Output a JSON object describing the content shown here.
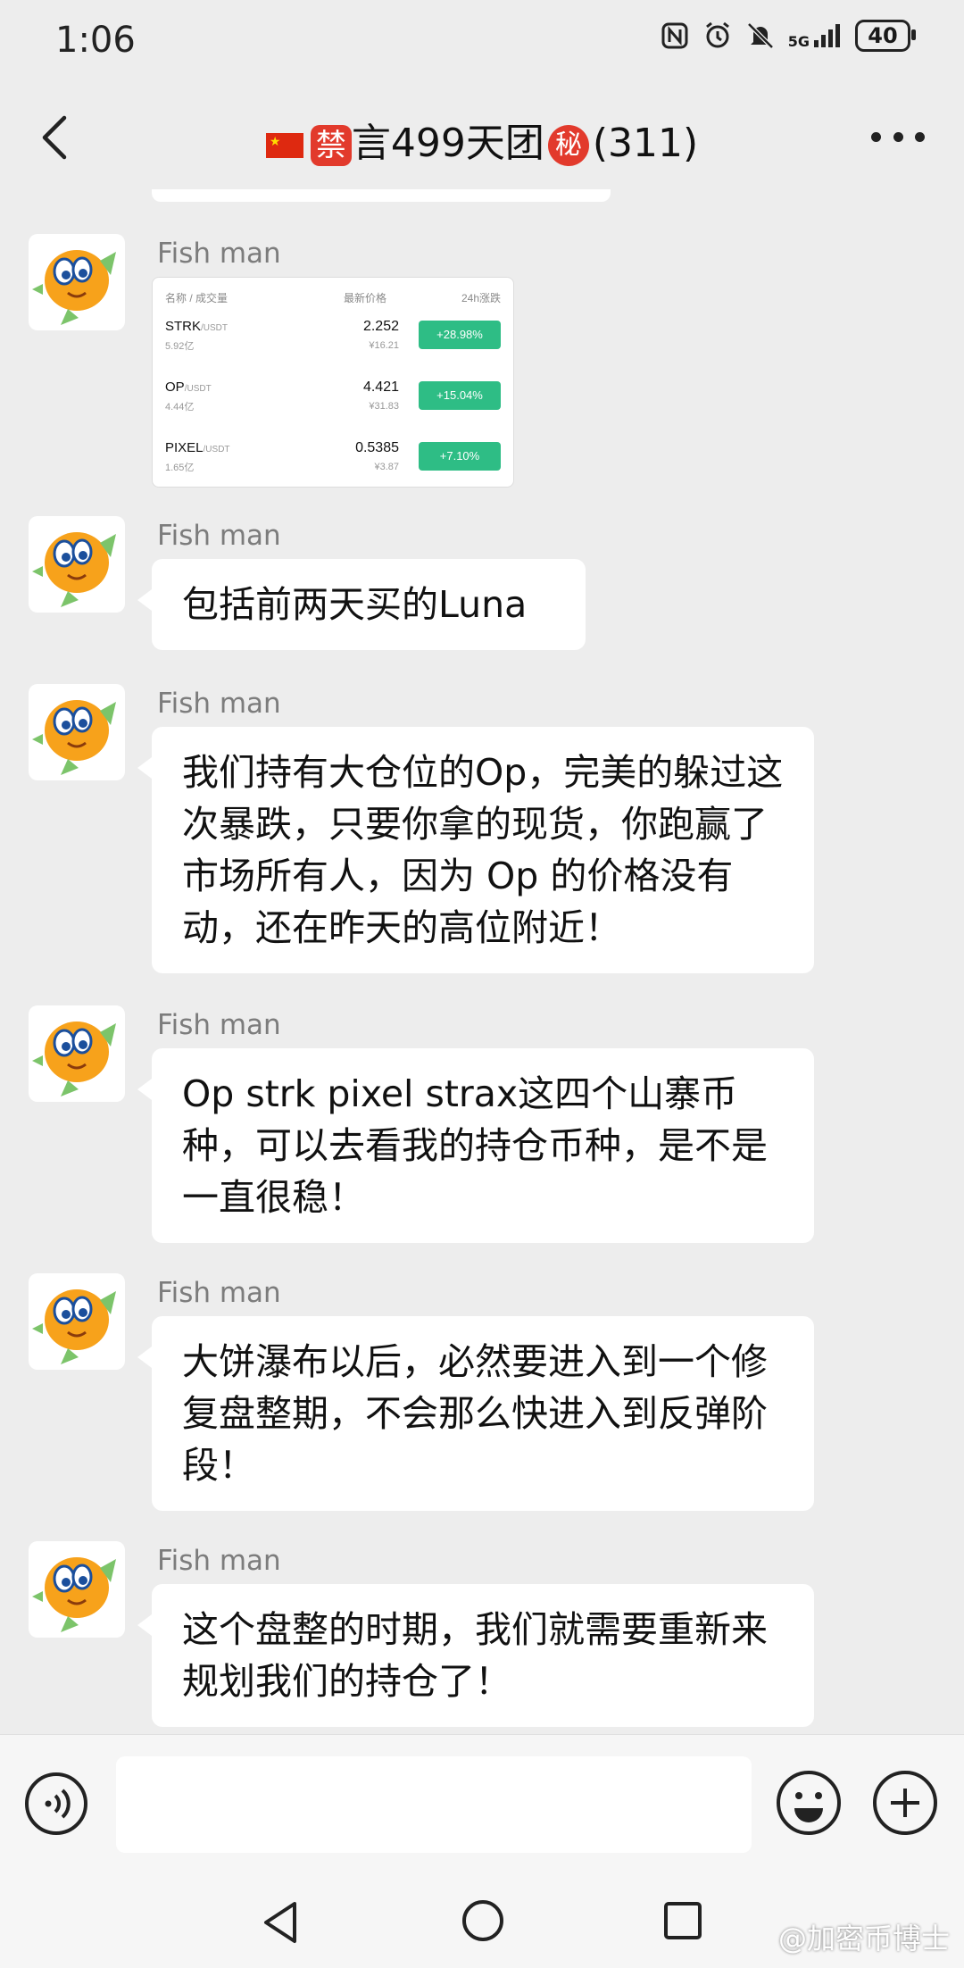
{
  "status_bar": {
    "time": "1:06",
    "network": "5G",
    "battery": "40"
  },
  "header": {
    "title_prefix": "禁",
    "title_main": "言499天团",
    "title_secret": "秘",
    "member_count": "(311)"
  },
  "chat": {
    "image_message": {
      "sender": "Fish man",
      "card": {
        "col_name": "名称 / 成交量",
        "col_price": "最新价格",
        "col_change": "24h涨跌",
        "rows": [
          {
            "symbol": "STRK",
            "quote": "/USDT",
            "volume": "5.92亿",
            "price": "2.252",
            "cny": "¥16.21",
            "change": "+28.98%"
          },
          {
            "symbol": "OP",
            "quote": "/USDT",
            "volume": "4.44亿",
            "price": "4.421",
            "cny": "¥31.83",
            "change": "+15.04%"
          },
          {
            "symbol": "PIXEL",
            "quote": "/USDT",
            "volume": "1.65亿",
            "price": "0.5385",
            "cny": "¥3.87",
            "change": "+7.10%"
          }
        ]
      }
    },
    "messages": [
      {
        "sender": "Fish man",
        "text": "包括前两天买的Luna"
      },
      {
        "sender": "Fish man",
        "text": "我们持有大仓位的Op，完美的躲过这次暴跌，只要你拿的现货，你跑赢了市场所有人，因为 Op 的价格没有动，还在昨天的高位附近！"
      },
      {
        "sender": "Fish man",
        "text": "Op strk pixel strax这四个山寨币种，可以去看我的持仓币种，是不是一直很稳！"
      },
      {
        "sender": "Fish man",
        "text": "大饼瀑布以后，必然要进入到一个修复盘整期，不会那么快进入到反弹阶段！"
      },
      {
        "sender": "Fish man",
        "text": "这个盘整的时期，我们就需要重新来规划我们的持仓了！"
      }
    ]
  },
  "input": {
    "value": ""
  },
  "watermark": "@加密币博士",
  "icons": {
    "back": "chevron-left-icon",
    "more": "more-dots-icon",
    "voice": "voice-icon",
    "emoji": "emoji-icon",
    "plus": "plus-icon"
  }
}
